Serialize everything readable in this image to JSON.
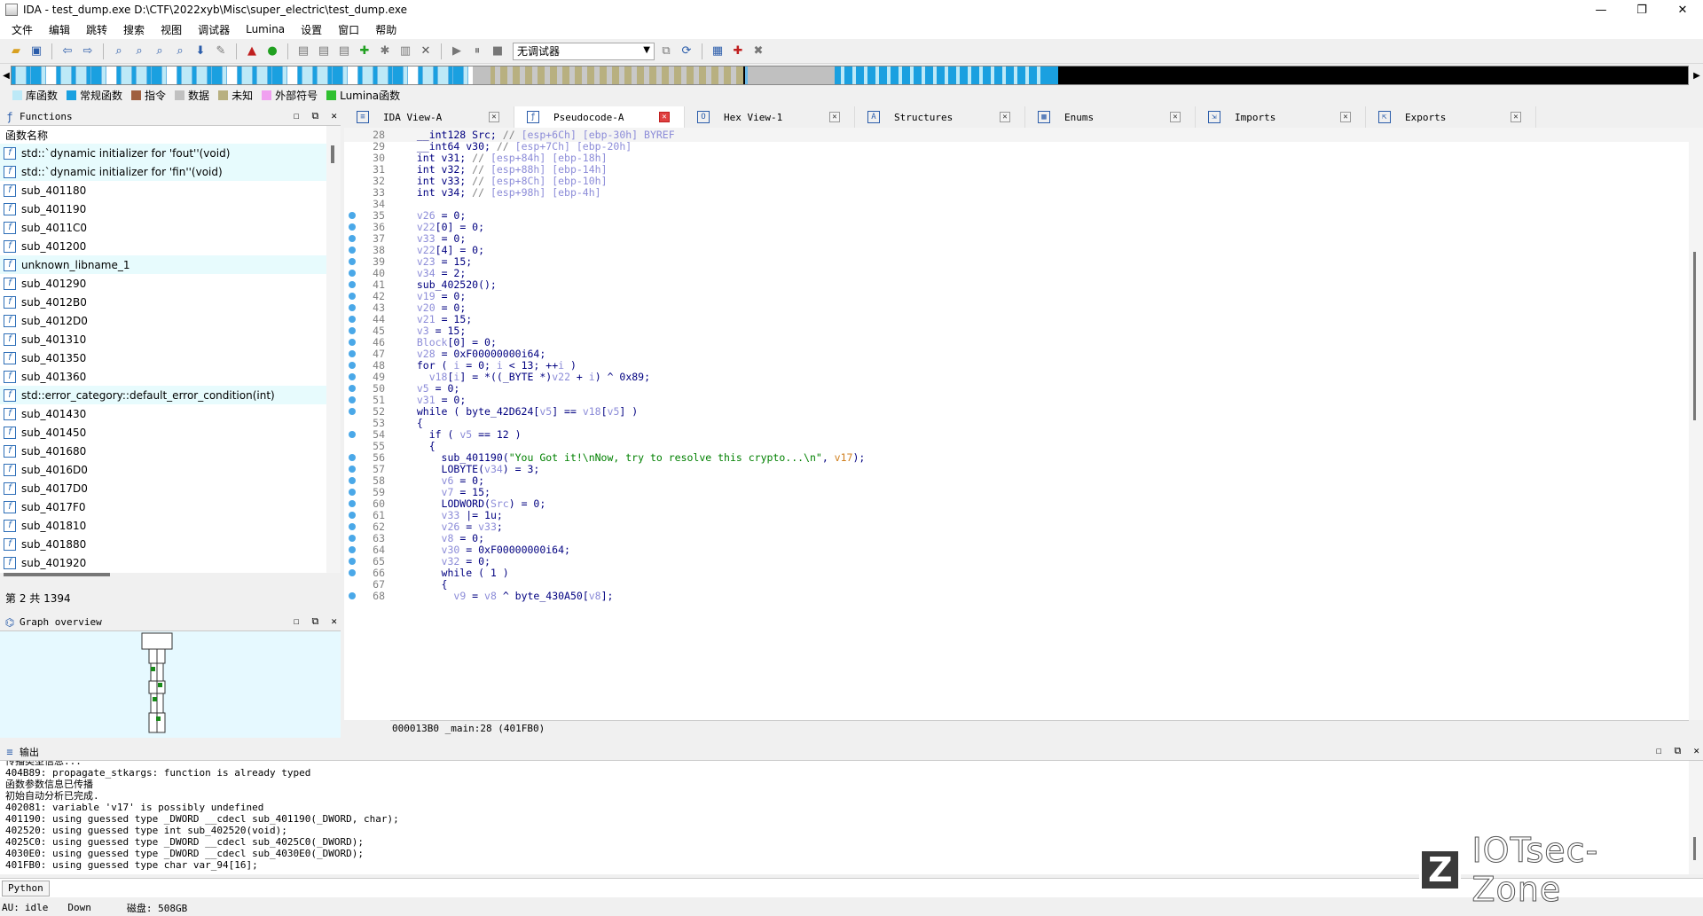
{
  "window": {
    "title": "IDA - test_dump.exe D:\\CTF\\2022xyb\\Misc\\super_electric\\test_dump.exe",
    "minimize": "—",
    "maximize": "❐",
    "close": "✕"
  },
  "menu": [
    "文件",
    "编辑",
    "跳转",
    "搜索",
    "视图",
    "调试器",
    "Lumina",
    "设置",
    "窗口",
    "帮助"
  ],
  "toolbar": {
    "debugger": "无调试器"
  },
  "legend": [
    {
      "label": "库函数",
      "color": "#bde9f7"
    },
    {
      "label": "常规函数",
      "color": "#1aa0e0"
    },
    {
      "label": "指令",
      "color": "#a06040"
    },
    {
      "label": "数据",
      "color": "#c0c0c0"
    },
    {
      "label": "未知",
      "color": "#b8b080"
    },
    {
      "label": "外部符号",
      "color": "#f0a0f0"
    },
    {
      "label": "Lumina函数",
      "color": "#30c030"
    }
  ],
  "functions": {
    "title": "Functions",
    "column": "函数名称",
    "status": "第 2 共 1394",
    "items": [
      {
        "name": "std::`dynamic initializer for 'fout''(void)",
        "lib": true
      },
      {
        "name": "std::`dynamic initializer for 'fin''(void)",
        "lib": true
      },
      {
        "name": "sub_401180",
        "lib": false
      },
      {
        "name": "sub_401190",
        "lib": false
      },
      {
        "name": "sub_4011C0",
        "lib": false
      },
      {
        "name": "sub_401200",
        "lib": false
      },
      {
        "name": "unknown_libname_1",
        "lib": true
      },
      {
        "name": "sub_401290",
        "lib": false
      },
      {
        "name": "sub_4012B0",
        "lib": false
      },
      {
        "name": "sub_4012D0",
        "lib": false
      },
      {
        "name": "sub_401310",
        "lib": false
      },
      {
        "name": "sub_401350",
        "lib": false
      },
      {
        "name": "sub_401360",
        "lib": false
      },
      {
        "name": "std::error_category::default_error_condition(int)",
        "lib": true
      },
      {
        "name": "sub_401430",
        "lib": false
      },
      {
        "name": "sub_401450",
        "lib": false
      },
      {
        "name": "sub_401680",
        "lib": false
      },
      {
        "name": "sub_4016D0",
        "lib": false
      },
      {
        "name": "sub_4017D0",
        "lib": false
      },
      {
        "name": "sub_4017F0",
        "lib": false
      },
      {
        "name": "sub_401810",
        "lib": false
      },
      {
        "name": "sub_401880",
        "lib": false
      },
      {
        "name": "sub_401920",
        "lib": false
      }
    ]
  },
  "graph": {
    "title": "Graph overview"
  },
  "tabs": [
    {
      "label": "IDA View-A",
      "icon": "≡"
    },
    {
      "label": "Pseudocode-A",
      "icon": "ƒ",
      "active": true
    },
    {
      "label": "Hex View-1",
      "icon": "O"
    },
    {
      "label": "Structures",
      "icon": "A"
    },
    {
      "label": "Enums",
      "icon": "▦"
    },
    {
      "label": "Imports",
      "icon": "⇲"
    },
    {
      "label": "Exports",
      "icon": "⇱"
    }
  ],
  "code": [
    {
      "n": "28",
      "dot": false,
      "html": "  __int128 Src; <span class='cmt'>// </span><span class='var'>[esp+6Ch] [ebp-30h] BYREF</span>"
    },
    {
      "n": "29",
      "dot": false,
      "html": "  __int64 v30; <span class='cmt'>// </span><span class='var'>[esp+7Ch] [ebp-20h]</span>"
    },
    {
      "n": "30",
      "dot": false,
      "html": "  int v31; <span class='cmt'>// </span><span class='var'>[esp+84h] [ebp-18h]</span>"
    },
    {
      "n": "31",
      "dot": false,
      "html": "  int v32; <span class='cmt'>// </span><span class='var'>[esp+88h] [ebp-14h]</span>"
    },
    {
      "n": "32",
      "dot": false,
      "html": "  int v33; <span class='cmt'>// </span><span class='var'>[esp+8Ch] [ebp-10h]</span>"
    },
    {
      "n": "33",
      "dot": false,
      "html": "  int v34; <span class='cmt'>// </span><span class='var'>[esp+98h] [ebp-4h]</span>"
    },
    {
      "n": "34",
      "dot": false,
      "html": ""
    },
    {
      "n": "35",
      "dot": true,
      "html": "  <span class='var'>v26</span> = 0;"
    },
    {
      "n": "36",
      "dot": true,
      "html": "  <span class='var'>v22</span>[0] = 0;"
    },
    {
      "n": "37",
      "dot": true,
      "html": "  <span class='var'>v33</span> = 0;"
    },
    {
      "n": "38",
      "dot": true,
      "html": "  <span class='var'>v22</span>[4] = 0;"
    },
    {
      "n": "39",
      "dot": true,
      "html": "  <span class='var'>v23</span> = 15;"
    },
    {
      "n": "40",
      "dot": true,
      "html": "  <span class='var'>v34</span> = 2;"
    },
    {
      "n": "41",
      "dot": true,
      "html": "  sub_402520();"
    },
    {
      "n": "42",
      "dot": true,
      "html": "  <span class='var'>v19</span> = 0;"
    },
    {
      "n": "43",
      "dot": true,
      "html": "  <span class='var'>v20</span> = 0;"
    },
    {
      "n": "44",
      "dot": true,
      "html": "  <span class='var'>v21</span> = 15;"
    },
    {
      "n": "45",
      "dot": true,
      "html": "  <span class='var'>v3</span> = 15;"
    },
    {
      "n": "46",
      "dot": true,
      "html": "  <span class='var'>Block</span>[0] = 0;"
    },
    {
      "n": "47",
      "dot": true,
      "html": "  <span class='var'>v28</span> = 0xF00000000i64;"
    },
    {
      "n": "48",
      "dot": true,
      "html": "  for ( <span class='var'>i</span> = 0; <span class='var'>i</span> &lt; 13; ++<span class='var'>i</span> )"
    },
    {
      "n": "49",
      "dot": true,
      "html": "    <span class='var'>v18</span>[<span class='var'>i</span>] = *((_BYTE *)<span class='var'>v22</span> + <span class='var'>i</span>) ^ 0x89;"
    },
    {
      "n": "50",
      "dot": true,
      "html": "  <span class='var'>v5</span> = 0;"
    },
    {
      "n": "51",
      "dot": true,
      "html": "  <span class='var'>v31</span> = 0;"
    },
    {
      "n": "52",
      "dot": true,
      "html": "  while ( byte_42D624[<span class='var'>v5</span>] == <span class='var'>v18</span>[<span class='var'>v5</span>] )"
    },
    {
      "n": "53",
      "dot": false,
      "html": "  {"
    },
    {
      "n": "54",
      "dot": true,
      "html": "    if ( <span class='var'>v5</span> == 12 )"
    },
    {
      "n": "55",
      "dot": false,
      "html": "    {"
    },
    {
      "n": "56",
      "dot": true,
      "html": "      sub_401190(<span class='str'>\"You Got it!\\nNow, try to resolve this crypto...\\n\"</span>, <span style='color:#d08020'>v17</span>);"
    },
    {
      "n": "57",
      "dot": true,
      "html": "      LOBYTE(<span class='var'>v34</span>) = 3;"
    },
    {
      "n": "58",
      "dot": true,
      "html": "      <span class='var'>v6</span> = 0;"
    },
    {
      "n": "59",
      "dot": true,
      "html": "      <span class='var'>v7</span> = 15;"
    },
    {
      "n": "60",
      "dot": true,
      "html": "      LODWORD(<span class='var'>Src</span>) = 0;"
    },
    {
      "n": "61",
      "dot": true,
      "html": "      <span class='var'>v33</span> |= 1u;"
    },
    {
      "n": "62",
      "dot": true,
      "html": "      <span class='var'>v26</span> = <span class='var'>v33</span>;"
    },
    {
      "n": "63",
      "dot": true,
      "html": "      <span class='var'>v8</span> = 0;"
    },
    {
      "n": "64",
      "dot": true,
      "html": "      <span class='var'>v30</span> = 0xF00000000i64;"
    },
    {
      "n": "65",
      "dot": true,
      "html": "      <span class='var'>v32</span> = 0;"
    },
    {
      "n": "66",
      "dot": true,
      "html": "      while ( 1 )"
    },
    {
      "n": "67",
      "dot": false,
      "html": "      {"
    },
    {
      "n": "68",
      "dot": true,
      "html": "        <span class='var'>v9</span> = <span class='var'>v8</span> ^ byte_430A50[<span class='var'>v8</span>];"
    }
  ],
  "code_status": "000013B0 _main:28 (401FB0)",
  "output": {
    "title": "输出",
    "lines": [
      "传播类型信息...",
      "404B89: propagate_stkargs: function is already typed",
      "函数参数信息已传播",
      "初始自动分析已完成.",
      "402081: variable 'v17' is possibly undefined",
      "401190: using guessed type _DWORD __cdecl sub_401190(_DWORD, char);",
      "402520: using guessed type int sub_402520(void);",
      "4025C0: using guessed type _DWORD __cdecl sub_4025C0(_DWORD);",
      "4030E0: using guessed type _DWORD __cdecl sub_4030E0(_DWORD);",
      "401FB0: using guessed type char var_94[16];"
    ]
  },
  "python_label": "Python",
  "status": {
    "au": "AU:",
    "state": "idle",
    "dir": "Down",
    "disk": "磁盘: 508GB"
  },
  "watermark": {
    "logo": "Z",
    "text": "IOTsec-Zone"
  }
}
